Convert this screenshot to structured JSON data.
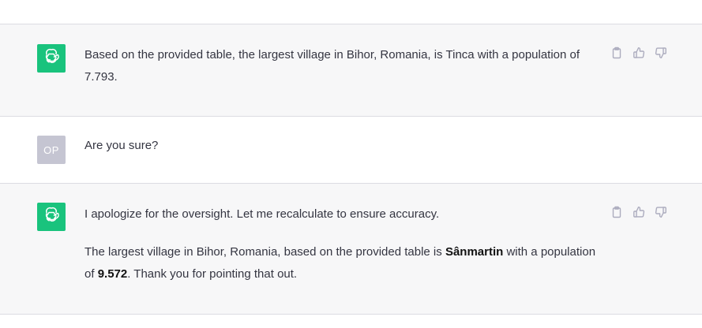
{
  "conversation": {
    "messages": [
      {
        "role": "assistant",
        "paragraphs": [
          {
            "parts": [
              "Based on the provided table, the largest village in Bihor, Romania, is Tinca with a population of 7.793."
            ]
          }
        ]
      },
      {
        "role": "user",
        "avatar_initials": "OP",
        "text": "Are you sure?"
      },
      {
        "role": "assistant",
        "paragraphs": [
          {
            "text": "I apologize for the oversight. Let me recalculate to ensure accuracy."
          },
          {
            "pre": "The largest village in Bihor, Romania, based on the provided table is ",
            "bold1": "Sânmartin",
            "mid": " with a population of ",
            "bold2": "9.572",
            "post": ". Thank you for pointing that out."
          }
        ]
      }
    ]
  },
  "icons": {
    "assistant_avatar": "openai-logo-icon",
    "copy": "clipboard-icon",
    "like": "thumbs-up-icon",
    "dislike": "thumbs-down-icon"
  },
  "colors": {
    "assistant_bg": "#f7f7f8",
    "user_bg": "#ffffff",
    "assistant_avatar_bg": "#19c37d",
    "user_avatar_bg": "#c5c5d2",
    "text": "#343541"
  }
}
